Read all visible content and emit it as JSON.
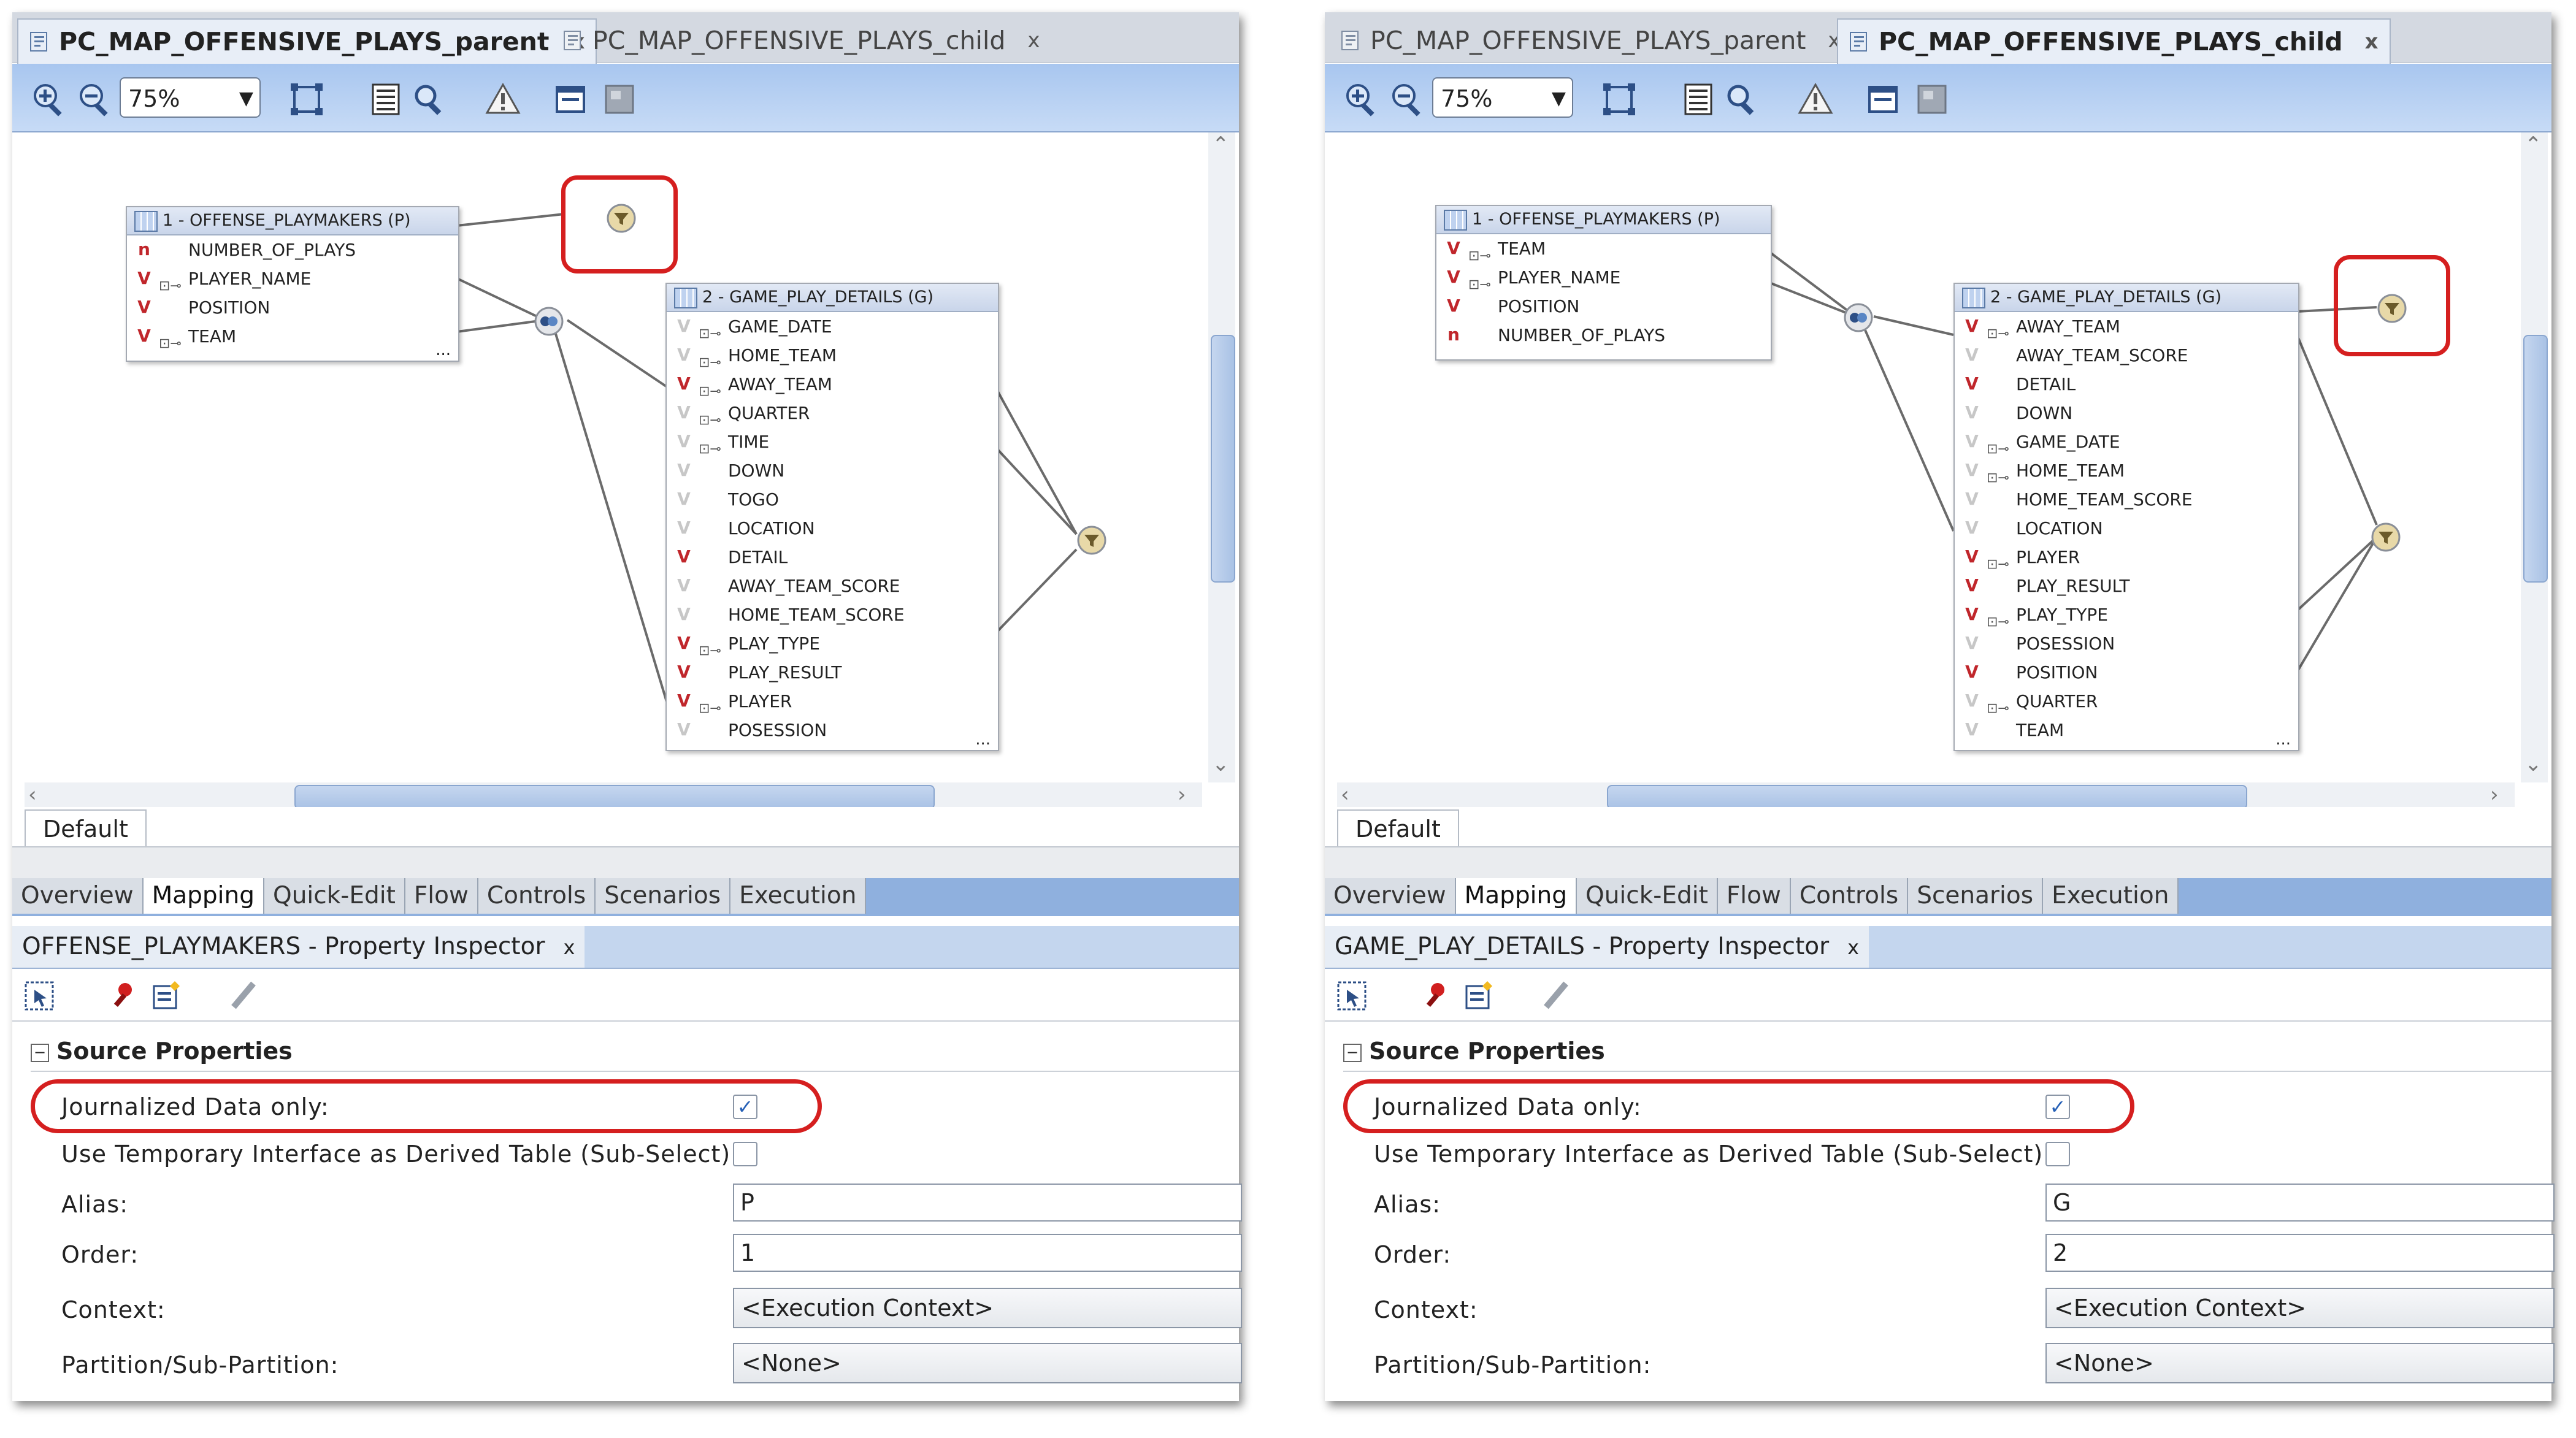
{
  "left": {
    "tabs": [
      {
        "label": "PC_MAP_OFFENSIVE_PLAYS_parent",
        "close": "x"
      },
      {
        "label": "PC_MAP_OFFENSIVE_PLAYS_child",
        "close": "x"
      }
    ],
    "zoom": "75%",
    "source1": {
      "title": "1 - OFFENSE_PLAYMAKERS (P)",
      "rows": [
        {
          "type": "n",
          "name": "NUMBER_OF_PLAYS",
          "key": false
        },
        {
          "type": "v",
          "name": "PLAYER_NAME",
          "key": true
        },
        {
          "type": "v",
          "name": "POSITION",
          "key": false
        },
        {
          "type": "v",
          "name": "TEAM",
          "key": true
        }
      ]
    },
    "source2": {
      "title": "2 - GAME_PLAY_DETAILS (G)",
      "rows": [
        {
          "type": "g",
          "name": "GAME_DATE",
          "key": true
        },
        {
          "type": "g",
          "name": "HOME_TEAM",
          "key": true
        },
        {
          "type": "v",
          "name": "AWAY_TEAM",
          "key": true
        },
        {
          "type": "g",
          "name": "QUARTER",
          "key": true
        },
        {
          "type": "g",
          "name": "TIME",
          "key": true
        },
        {
          "type": "g",
          "name": "DOWN",
          "key": false
        },
        {
          "type": "g",
          "name": "TOGO",
          "key": false
        },
        {
          "type": "g",
          "name": "LOCATION",
          "key": false
        },
        {
          "type": "v",
          "name": "DETAIL",
          "key": false
        },
        {
          "type": "g",
          "name": "AWAY_TEAM_SCORE",
          "key": false
        },
        {
          "type": "g",
          "name": "HOME_TEAM_SCORE",
          "key": false
        },
        {
          "type": "v",
          "name": "PLAY_TYPE",
          "key": true
        },
        {
          "type": "v",
          "name": "PLAY_RESULT",
          "key": false
        },
        {
          "type": "v",
          "name": "PLAYER",
          "key": true
        },
        {
          "type": "g",
          "name": "POSESSION",
          "key": false
        }
      ]
    },
    "more": "...",
    "default_tab": "Default",
    "nav_tabs": [
      "Overview",
      "Mapping",
      "Quick-Edit",
      "Flow",
      "Controls",
      "Scenarios",
      "Execution"
    ],
    "active_nav": "Mapping",
    "inspector_title": "OFFENSE_PLAYMAKERS - Property Inspector",
    "section": "Source Properties",
    "props": {
      "journalized_label": "Journalized Data only:",
      "journalized_checked": true,
      "temp_label": "Use Temporary Interface as Derived Table (Sub-Select):",
      "temp_checked": false,
      "alias_label": "Alias:",
      "alias_value": "P",
      "order_label": "Order:",
      "order_value": "1",
      "context_label": "Context:",
      "context_value": "<Execution Context>",
      "partition_label": "Partition/Sub-Partition:",
      "partition_value": "<None>"
    }
  },
  "right": {
    "tabs": [
      {
        "label": "PC_MAP_OFFENSIVE_PLAYS_parent",
        "close": "x"
      },
      {
        "label": "PC_MAP_OFFENSIVE_PLAYS_child",
        "close": "x"
      }
    ],
    "zoom": "75%",
    "source1": {
      "title": "1 - OFFENSE_PLAYMAKERS (P)",
      "rows": [
        {
          "type": "v",
          "name": "TEAM",
          "key": true
        },
        {
          "type": "v",
          "name": "PLAYER_NAME",
          "key": true
        },
        {
          "type": "v",
          "name": "POSITION",
          "key": false
        },
        {
          "type": "n",
          "name": "NUMBER_OF_PLAYS",
          "key": false
        }
      ]
    },
    "source2": {
      "title": "2 - GAME_PLAY_DETAILS (G)",
      "rows": [
        {
          "type": "v",
          "name": "AWAY_TEAM",
          "key": true
        },
        {
          "type": "g",
          "name": "AWAY_TEAM_SCORE",
          "key": false
        },
        {
          "type": "v",
          "name": "DETAIL",
          "key": false
        },
        {
          "type": "g",
          "name": "DOWN",
          "key": false
        },
        {
          "type": "g",
          "name": "GAME_DATE",
          "key": true
        },
        {
          "type": "g",
          "name": "HOME_TEAM",
          "key": true
        },
        {
          "type": "g",
          "name": "HOME_TEAM_SCORE",
          "key": false
        },
        {
          "type": "g",
          "name": "LOCATION",
          "key": false
        },
        {
          "type": "v",
          "name": "PLAYER",
          "key": true
        },
        {
          "type": "v",
          "name": "PLAY_RESULT",
          "key": false
        },
        {
          "type": "v",
          "name": "PLAY_TYPE",
          "key": true
        },
        {
          "type": "g",
          "name": "POSESSION",
          "key": false
        },
        {
          "type": "v",
          "name": "POSITION",
          "key": false
        },
        {
          "type": "g",
          "name": "QUARTER",
          "key": true
        },
        {
          "type": "g",
          "name": "TEAM",
          "key": false
        }
      ]
    },
    "more": "...",
    "default_tab": "Default",
    "nav_tabs": [
      "Overview",
      "Mapping",
      "Quick-Edit",
      "Flow",
      "Controls",
      "Scenarios",
      "Execution"
    ],
    "active_nav": "Mapping",
    "inspector_title": "GAME_PLAY_DETAILS - Property Inspector",
    "section": "Source Properties",
    "props": {
      "journalized_label": "Journalized Data only:",
      "journalized_checked": true,
      "temp_label": "Use Temporary Interface as Derived Table (Sub-Select):",
      "temp_checked": false,
      "alias_label": "Alias:",
      "alias_value": "G",
      "order_label": "Order:",
      "order_value": "2",
      "context_label": "Context:",
      "context_value": "<Execution Context>",
      "partition_label": "Partition/Sub-Partition:",
      "partition_value": "<None>"
    }
  },
  "icons": {
    "zoom_in": "zoom-in-icon",
    "zoom_out": "zoom-out-icon",
    "fit": "fit-diagram-icon",
    "properties": "properties-icon",
    "search": "search-icon",
    "warning": "warning-icon",
    "window": "window-icon",
    "join": "join-icon",
    "filter": "filter-icon"
  },
  "colors": {
    "highlight_ring": "#d51f1f",
    "toolbar": "#a8c6ef",
    "varchar_type": "#c0262b"
  }
}
